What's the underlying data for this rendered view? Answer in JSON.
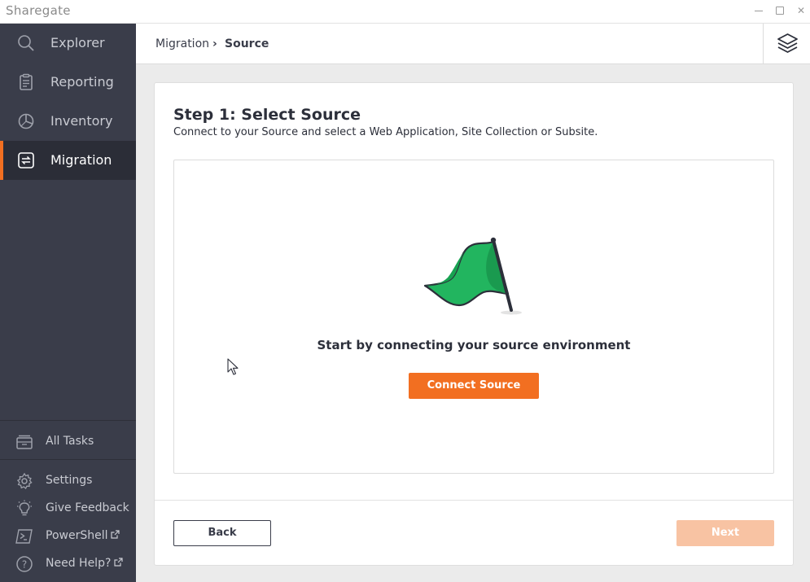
{
  "app": {
    "logo_text": "Sharegate",
    "accent_color": "#f26f21",
    "window_controls": [
      "minimize",
      "maximize",
      "close"
    ]
  },
  "sidebar": {
    "nav_items": [
      {
        "label": "Explorer",
        "icon": "search-icon",
        "active": false
      },
      {
        "label": "Reporting",
        "icon": "clipboard-icon",
        "active": false
      },
      {
        "label": "Inventory",
        "icon": "pie-chart-icon",
        "active": false
      },
      {
        "label": "Migration",
        "icon": "swap-arrows-icon",
        "active": true
      }
    ],
    "all_tasks": {
      "label": "All Tasks",
      "icon": "archive-box-icon"
    },
    "bottom_items": [
      {
        "label": "Settings",
        "icon": "gear-icon"
      },
      {
        "label": "Give Feedback",
        "icon": "lightbulb-icon"
      },
      {
        "label": "PowerShell",
        "icon": "terminal-icon",
        "external": true
      },
      {
        "label": "Need Help?",
        "icon": "question-circle-icon",
        "external": true
      }
    ]
  },
  "header": {
    "breadcrumb": [
      "Migration",
      "Source"
    ],
    "separator": "›",
    "right_icon": "layers-icon"
  },
  "main": {
    "step_title": "Step 1: Select Source",
    "step_subtitle": "Connect to your Source and select a Web Application, Site Collection or Subsite.",
    "empty_state_text": "Start by connecting your source environment",
    "connect_button": "Connect Source",
    "empty_state_icon": "green-flag-icon",
    "back_button": "Back",
    "next_button": "Next",
    "next_enabled": false
  }
}
